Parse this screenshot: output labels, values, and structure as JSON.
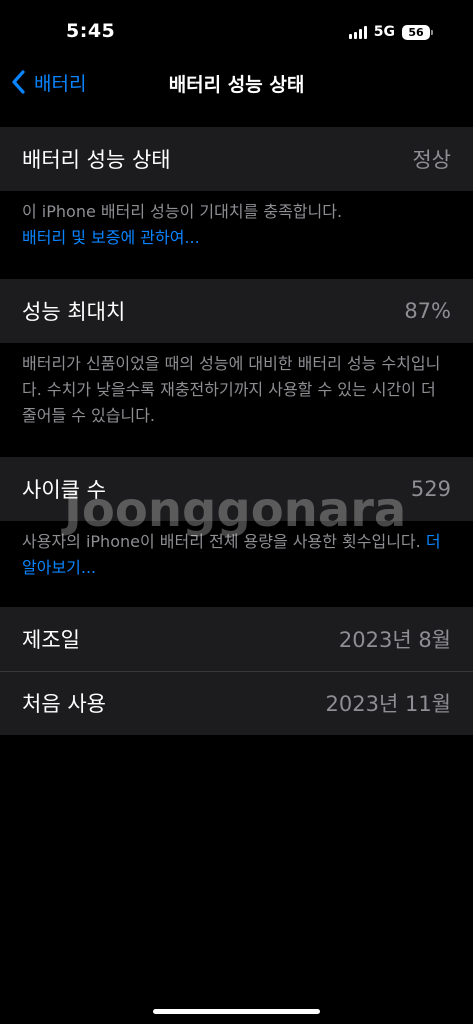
{
  "status_bar": {
    "time": "5:45",
    "network": "5G",
    "battery_level": "56",
    "signal_icon": "cellular-signal-icon",
    "battery_icon": "battery-icon"
  },
  "nav": {
    "back_label": "배터리",
    "back_icon": "chevron-left-icon",
    "title": "배터리 성능 상태"
  },
  "health_section": {
    "label": "배터리 성능 상태",
    "value": "정상",
    "footer_text": "이 iPhone 배터리 성능이 기대치를 충족합니다.",
    "footer_link": "배터리 및 보증에 관하여..."
  },
  "capacity_section": {
    "label": "성능 최대치",
    "value": "87%",
    "footer_text": "배터리가 신품이었을 때의 성능에 대비한 배터리 성능 수치입니다. 수치가 낮을수록 재충전하기까지 사용할 수 있는 시간이 더 줄어들 수 있습니다."
  },
  "cycle_section": {
    "label": "사이클 수",
    "value": "529",
    "footer_text": "사용자의 iPhone이 배터리 전체 용량을 사용한 횟수입니다.",
    "footer_link": "더 알아보기..."
  },
  "dates_section": {
    "manufacture_label": "제조일",
    "manufacture_value": "2023년 8월",
    "first_use_label": "처음 사용",
    "first_use_value": "2023년 11월"
  },
  "watermark": "Joonggonara",
  "colors": {
    "background": "#000000",
    "cell": "#1c1c1e",
    "accent": "#0a84ff",
    "secondary_text": "#8e8e93",
    "separator": "#38383a"
  }
}
